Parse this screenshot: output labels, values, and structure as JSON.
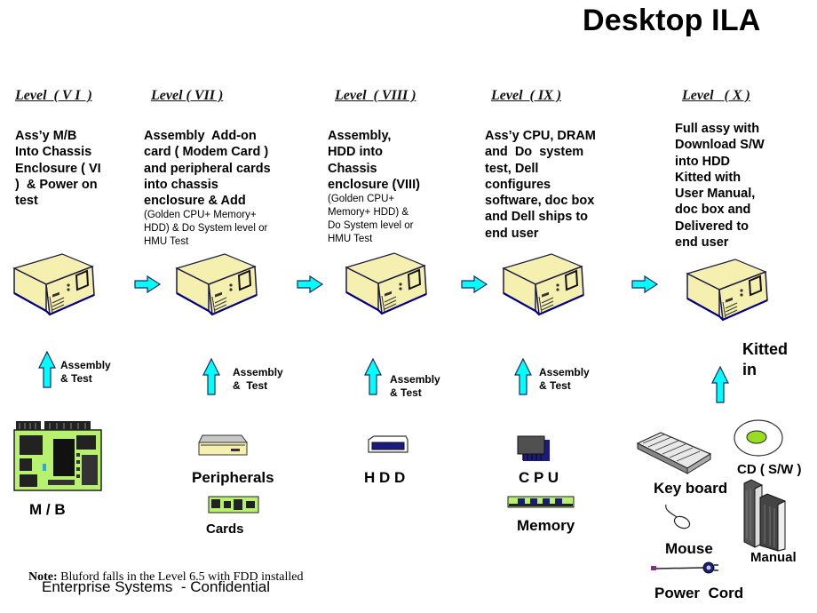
{
  "title": "Desktop ILA",
  "levels": [
    {
      "heading": "Level  ( V I  )",
      "description": [
        "Ass’y M/B",
        "Into Chassis",
        "Enclosure ( VI",
        ")  & Power on",
        "test"
      ],
      "sub_description": [],
      "input_label": [
        "Assembly",
        "& Test"
      ],
      "components": [
        {
          "name": "M / B",
          "icon": "motherboard-icon"
        }
      ]
    },
    {
      "heading": "Level ( VII )",
      "description": [
        "Assembly  Add-on",
        "card ( Modem Card )",
        "and peripheral cards",
        "into chassis",
        "enclosure & Add"
      ],
      "sub_description": [
        "(Golden CPU+ Memory+",
        "HDD) & Do System level or",
        "HMU Test"
      ],
      "input_label": [
        "Assembly",
        "&  Test"
      ],
      "components": [
        {
          "name": "Peripherals",
          "icon": "floppy-drive-icon"
        },
        {
          "name": "Cards",
          "icon": "expansion-card-icon"
        }
      ]
    },
    {
      "heading": "Level  ( VIII )",
      "description": [
        "Assembly,",
        "HDD into",
        "Chassis",
        "enclosure (VIII)"
      ],
      "sub_description": [
        "(Golden CPU+",
        "Memory+ HDD) &",
        "Do System level or",
        "HMU Test"
      ],
      "input_label": [
        "Assembly",
        "& Test"
      ],
      "components": [
        {
          "name": "H D D",
          "icon": "hard-drive-icon"
        }
      ]
    },
    {
      "heading": "Level  ( IX )",
      "description": [
        "Ass’y CPU, DRAM",
        "and  Do  system",
        "test, Dell",
        "configures",
        "software, doc box",
        "and Dell ships to",
        "end user"
      ],
      "sub_description": [],
      "input_label": [
        "Assembly",
        "& Test"
      ],
      "components": [
        {
          "name": "C P U",
          "icon": "cpu-chip-icon"
        },
        {
          "name": "Memory",
          "icon": "memory-module-icon"
        }
      ]
    },
    {
      "heading": "Level   ( X )",
      "description": [
        "Full assy with",
        "Download S/W",
        "into HDD",
        "Kitted with",
        "User Manual,",
        "doc box and",
        "Delivered to",
        "end user"
      ],
      "sub_description": [],
      "input_label": [
        "Kitted",
        "in"
      ],
      "components": [
        {
          "name": "Key board",
          "icon": "keyboard-icon"
        },
        {
          "name": "CD ( S/W )",
          "icon": "cd-disc-icon"
        },
        {
          "name": "Mouse",
          "icon": "mouse-icon"
        },
        {
          "name": "Manual",
          "icon": "manual-books-icon"
        },
        {
          "name": "Power  Cord",
          "icon": "power-cord-icon"
        }
      ]
    }
  ],
  "note": {
    "label": "Note:",
    "text": " Bluford falls in the Level 6.5 with FDD installed"
  },
  "footer": "Enterprise Systems  - Confidential",
  "colors": {
    "arrow": "#00FFFF",
    "arrow_stroke": "#1a2a60",
    "chassis": "#F5F0B0",
    "board": "#B8F070",
    "disc_center": "#99DD22",
    "chip": "#505050",
    "dark_blue": "#1a1a80"
  }
}
